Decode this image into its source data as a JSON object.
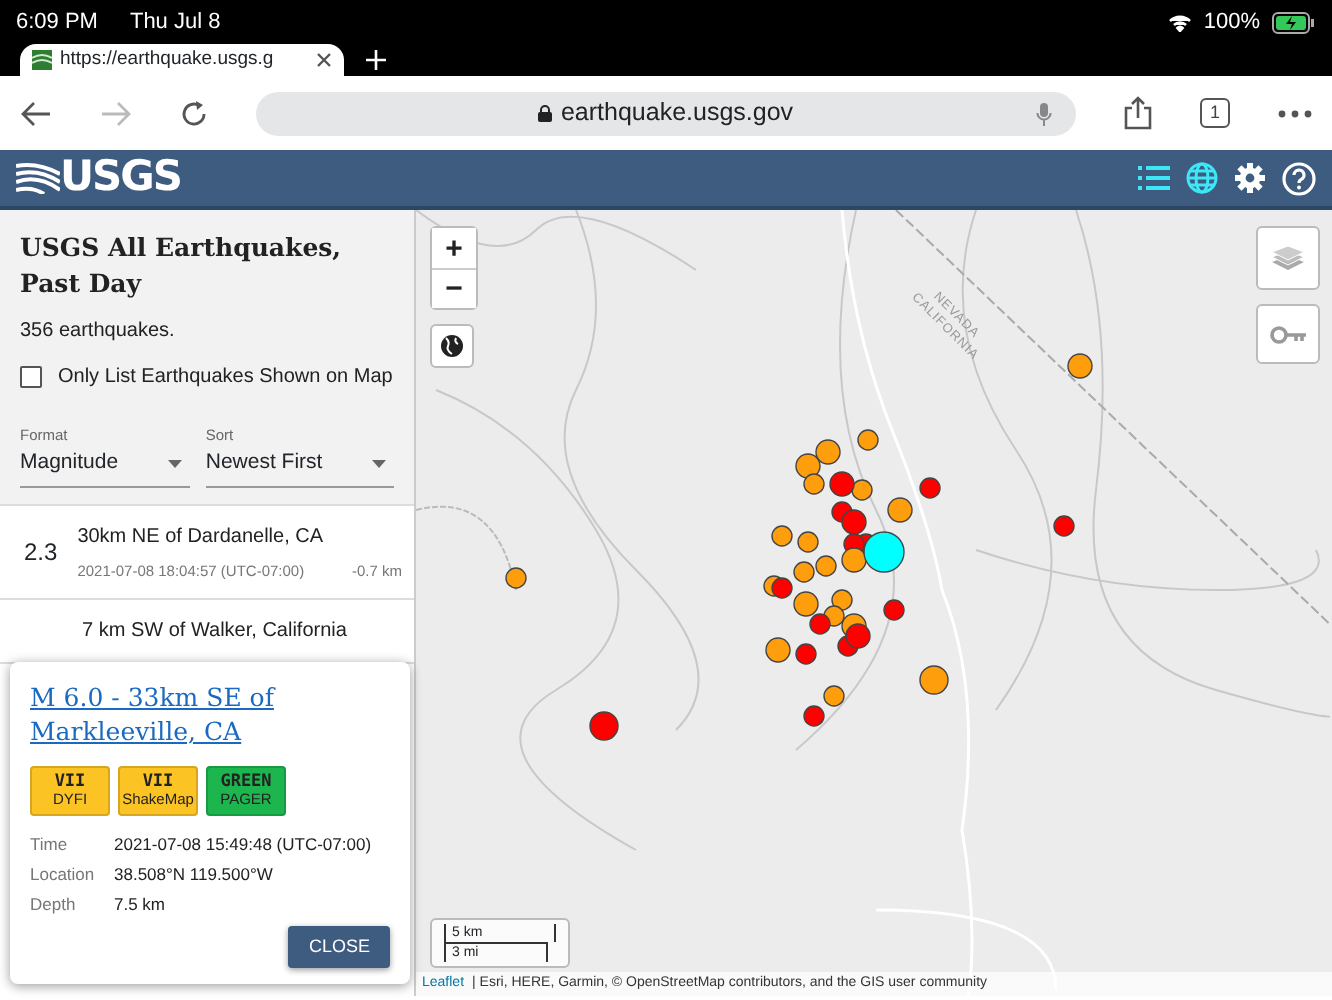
{
  "status_bar": {
    "time": "6:09 PM",
    "date": "Thu Jul 8",
    "battery": "100%"
  },
  "browser": {
    "tab_title": "https://earthquake.usgs.g",
    "url": "earthquake.usgs.gov",
    "tab_count": "1"
  },
  "header": {
    "logo": "USGS"
  },
  "sidebar": {
    "title": "USGS All Earthquakes, Past Day",
    "count": "356 earthquakes.",
    "filter": {
      "label": "Only List Earthquakes Shown on Map",
      "checked": false
    },
    "format": {
      "label": "Format",
      "value": "Magnitude"
    },
    "sort": {
      "label": "Sort",
      "value": "Newest First"
    },
    "events": [
      {
        "magnitude": "2.3",
        "title": "30km NE of Dardanelle, CA",
        "time": "2021-07-08 18:04:57 (UTC-07:00)",
        "depth": "-0.7 km"
      },
      {
        "title": "7 km SW of Walker, California"
      }
    ]
  },
  "popup": {
    "title": "M 6.0 - 33km SE of Markleeville, CA",
    "badges": [
      {
        "value": "VII",
        "label": "DYFI",
        "color": "#fcc324"
      },
      {
        "value": "VII",
        "label": "ShakeMap",
        "color": "#fcc324"
      },
      {
        "value": "GREEN",
        "label": "PAGER",
        "color": "#1db54e"
      }
    ],
    "details": [
      {
        "label": "Time",
        "value": "2021-07-08 15:49:48 (UTC-07:00)"
      },
      {
        "label": "Location",
        "value": "38.508°N 119.500°W"
      },
      {
        "label": "Depth",
        "value": "7.5 km"
      }
    ],
    "close": "CLOSE"
  },
  "map": {
    "zoom_in": "+",
    "zoom_out": "−",
    "state_labels": [
      "NEVADA",
      "CALIFORNIA"
    ],
    "scale": [
      "5 km",
      "3 mi"
    ],
    "attribution_link": "Leaflet",
    "attribution": "| Esri, HERE, Garmin, © OpenStreetMap contributors, and the GIS user community"
  }
}
